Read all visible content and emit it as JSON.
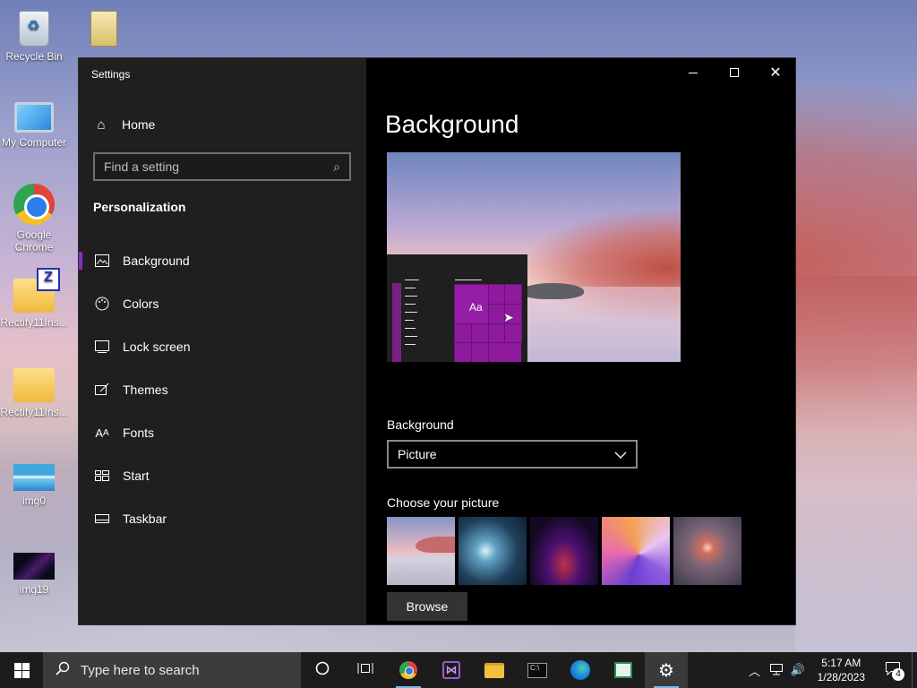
{
  "desktop": {
    "icons": [
      {
        "label": "Recycle Bin",
        "icon": "recycle-bin-icon"
      },
      {
        "label": "My Computer",
        "icon": "computer-icon"
      },
      {
        "label": "Google Chrome",
        "icon": "chrome-icon"
      },
      {
        "label": "Rectify11Ins...",
        "icon": "zip-folder-icon"
      },
      {
        "label": "Rectify11Ins...",
        "icon": "folder-icon"
      },
      {
        "label": "img0",
        "icon": "image-icon"
      },
      {
        "label": "img19",
        "icon": "image-icon"
      }
    ]
  },
  "window": {
    "title": "Settings",
    "controls": {
      "minimize": "minimize",
      "maximize": "maximize",
      "close": "✕"
    }
  },
  "sidebar": {
    "home_label": "Home",
    "search_placeholder": "Find a setting",
    "section": "Personalization",
    "items": [
      {
        "label": "Background",
        "icon": "picture-icon",
        "glyph": "🖼",
        "active": true
      },
      {
        "label": "Colors",
        "icon": "palette-icon",
        "glyph": "🎨",
        "active": false
      },
      {
        "label": "Lock screen",
        "icon": "lock-screen-icon",
        "glyph": "▭",
        "active": false
      },
      {
        "label": "Themes",
        "icon": "themes-brush-icon",
        "glyph": "✎",
        "active": false
      },
      {
        "label": "Fonts",
        "icon": "fonts-icon",
        "glyph": "A",
        "active": false
      },
      {
        "label": "Start",
        "icon": "start-grid-icon",
        "glyph": "▦",
        "active": false
      },
      {
        "label": "Taskbar",
        "icon": "taskbar-icon",
        "glyph": "▭",
        "active": false
      }
    ]
  },
  "main": {
    "title": "Background",
    "preview": {
      "tile_text": "Aa"
    },
    "background_label": "Background",
    "background_value": "Picture",
    "choose_label": "Choose your picture",
    "browse_label": "Browse"
  },
  "taskbar": {
    "search_placeholder": "Type here to search",
    "apps": [
      "cortana-icon",
      "task-view-icon",
      "chrome-icon",
      "visual-studio-icon",
      "file-explorer-icon",
      "terminal-icon",
      "edge-icon",
      "notepad-icon",
      "settings-icon"
    ],
    "time": "5:17 AM",
    "date": "1/28/2023",
    "notification_count": "4"
  },
  "colors": {
    "accent": "#8e1a9e",
    "taskbar": "#1c1c1c",
    "sidebar": "#1f1f1f"
  }
}
